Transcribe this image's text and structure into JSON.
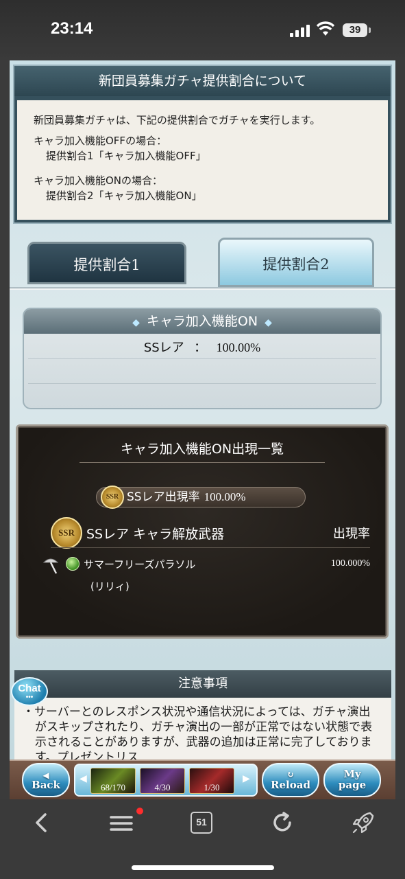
{
  "status_bar": {
    "time": "23:14",
    "battery": "39"
  },
  "info": {
    "title": "新団員募集ガチャ提供割合について",
    "intro": "新団員募集ガチャは、下記の提供割合でガチャを実行します。",
    "off_case": "キャラ加入機能OFFの場合：",
    "off_rate": "提供割合1「キャラ加入機能OFF」",
    "on_case": "キャラ加入機能ONの場合：",
    "on_rate": "提供割合2「キャラ加入機能ON」"
  },
  "tabs": [
    {
      "label": "提供割合1",
      "selected": false
    },
    {
      "label": "提供割合2",
      "selected": true
    }
  ],
  "rate_box": {
    "header": "キャラ加入機能ON",
    "line_label": "SSレア",
    "line_sep": "：",
    "line_value": "100.00%"
  },
  "list": {
    "title": "キャラ加入機能ON出現一覧",
    "pill_badge": "SSR",
    "pill_label": "SSレア出現率",
    "pill_value": "100.00%",
    "category_badge": "SSR",
    "category_label": "SSレア キャラ解放武器",
    "rate_header": "出現率",
    "items": [
      {
        "name": "サマーフリーズパラソル",
        "subname": "(リリィ)",
        "rate": "100.000%"
      }
    ]
  },
  "notes": {
    "title": "注意事項",
    "bullet": "・",
    "text": "サーバーとのレスポンス状況や通信状況によっては、ガチャ演出がスキップされたり、ガチャ演出の一部が正常ではない状態で表示されることがありますが、武器の追加は正常に完了しております。プレゼントリス"
  },
  "chat": {
    "label": "Chat",
    "dots": "•••"
  },
  "game_nav": {
    "back": "Back",
    "reload": "Reload",
    "mypage_line1": "My",
    "mypage_line2": "page",
    "quests": [
      "68/170",
      "4/30",
      "1/30"
    ]
  },
  "browser": {
    "tab_count": "51"
  },
  "colors": {
    "accent": "#2d8cbd",
    "panel_dark": "#1d1915",
    "notif": "#ff2d2d"
  }
}
